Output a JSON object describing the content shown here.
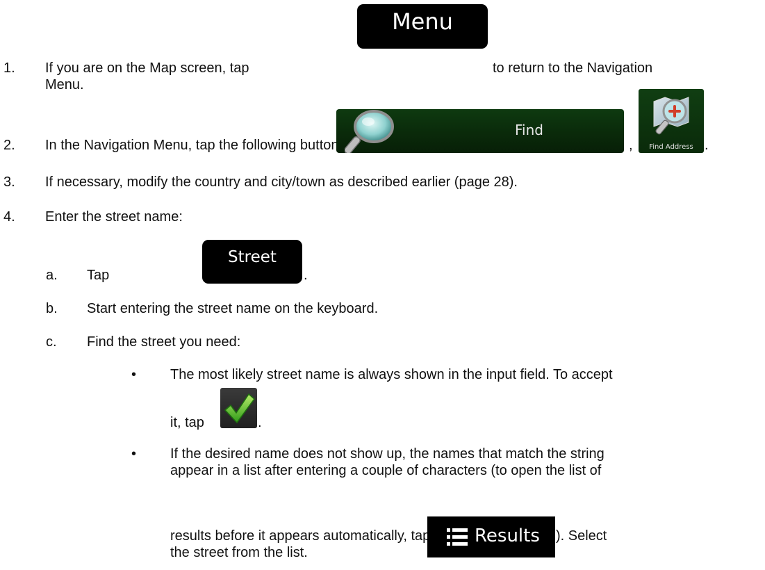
{
  "steps": [
    {
      "num": "1.",
      "line1_a": "If you are on the Map screen, tap",
      "line1_b": "to return to the Navigation",
      "line2": "Menu."
    },
    {
      "num": "2.",
      "text": "In the Navigation Menu, tap the following buttons:",
      "sep": ",",
      "end": "."
    },
    {
      "num": "3.",
      "text": "If necessary, modify the country and city/town as described earlier (page 28)."
    },
    {
      "num": "4.",
      "text": "Enter the street name:"
    }
  ],
  "substeps": [
    {
      "letter": "a.",
      "text": "Tap",
      "end": "."
    },
    {
      "letter": "b.",
      "text": "Start entering the street name on the keyboard."
    },
    {
      "letter": "c.",
      "text": "Find the street you need:"
    }
  ],
  "bullets": {
    "glyph": "•",
    "b1_line1": "The most likely street name is always shown in the input field. To accept",
    "b1_line2_a": "it, tap",
    "b1_end": ".",
    "b2_line1": "If the desired name does not show up, the names that match the string",
    "b2_line2": "appear in a list after entering a couple of characters (to open the list of",
    "b2_line3_a": "results before it appears automatically, tap",
    "b2_line3_b": "). Select",
    "b2_line4": "the street from the list."
  },
  "buttons": {
    "menu": "Menu",
    "find": "Find",
    "find_address": "Find Address",
    "street": "Street",
    "results": "Results"
  },
  "icons": {
    "find": "magnifier-icon",
    "find_address": "map-magnifier-icon",
    "accept": "checkmark-icon",
    "results": "list-icon"
  }
}
